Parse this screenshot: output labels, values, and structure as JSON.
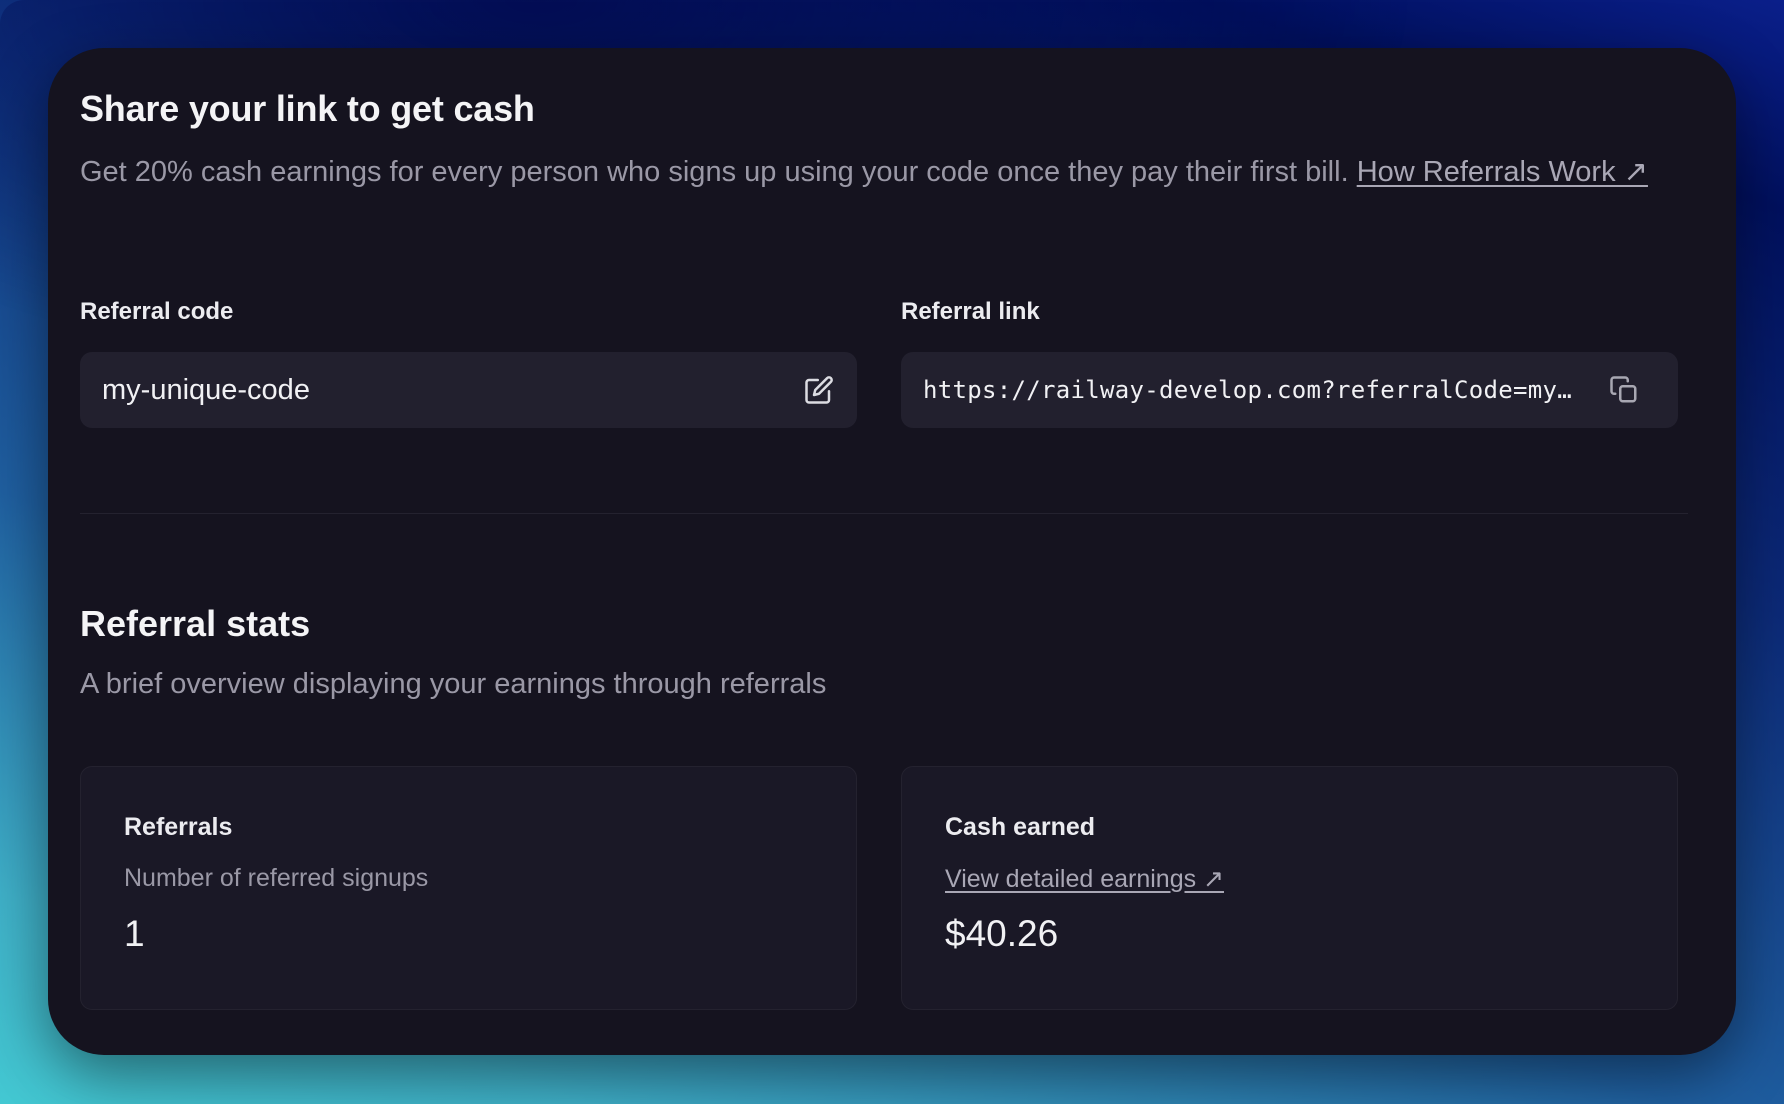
{
  "share": {
    "title": "Share your link to get cash",
    "description": "Get 20% cash earnings for every person who signs up using your code once they pay their first bill.",
    "link_label": "How Referrals Work ↗"
  },
  "referral_code": {
    "label": "Referral code",
    "value": "my-unique-code",
    "icon": "edit-icon"
  },
  "referral_link": {
    "label": "Referral link",
    "value": "https://railway-develop.com?referralCode=my-unique-code",
    "icon": "copy-icon"
  },
  "stats": {
    "title": "Referral stats",
    "description": "A brief overview displaying your earnings through referrals",
    "referrals": {
      "title": "Referrals",
      "subtitle": "Number of referred signups",
      "value": "1"
    },
    "cash": {
      "title": "Cash earned",
      "link_label": "View detailed earnings ↗",
      "value": "$40.26"
    }
  }
}
